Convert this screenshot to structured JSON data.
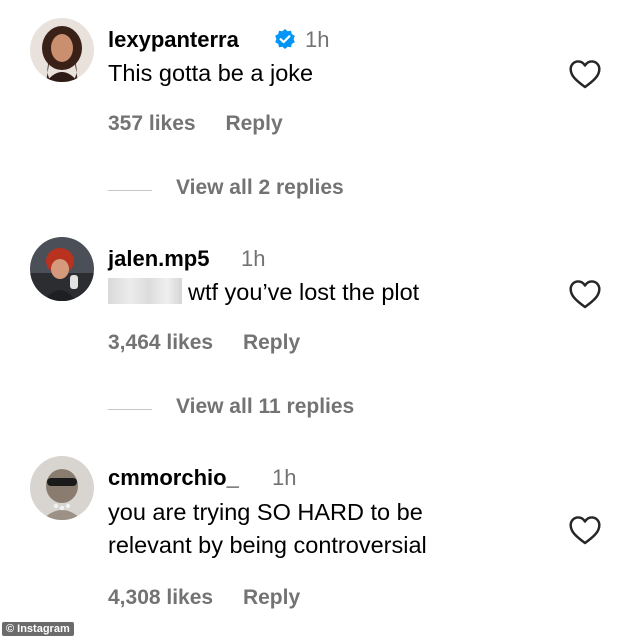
{
  "comments": [
    {
      "username": "lexypanterra",
      "verified": true,
      "time": "1h",
      "text_lines": [
        "This gotta be a joke"
      ],
      "likes": "357 likes",
      "reply": "Reply",
      "view_replies": "View all 2 replies"
    },
    {
      "username": "jalen.mp5",
      "verified": false,
      "time": "1h",
      "redacted_prefix": true,
      "text_lines": [
        "wtf you’ve lost the plot"
      ],
      "likes": "3,464 likes",
      "reply": "Reply",
      "view_replies": "View all 11 replies"
    },
    {
      "username": "cmmorchio_",
      "verified": false,
      "time": "1h",
      "text_lines": [
        "you are trying SO HARD to be",
        "relevant by being controversial"
      ],
      "likes": "4,308 likes",
      "reply": "Reply"
    }
  ],
  "watermark": "© Instagram",
  "icons": {
    "verified": "verified-badge-icon",
    "like": "heart-outline-icon"
  },
  "colors": {
    "verified_blue": "#0095f6",
    "secondary_text": "#737373"
  }
}
